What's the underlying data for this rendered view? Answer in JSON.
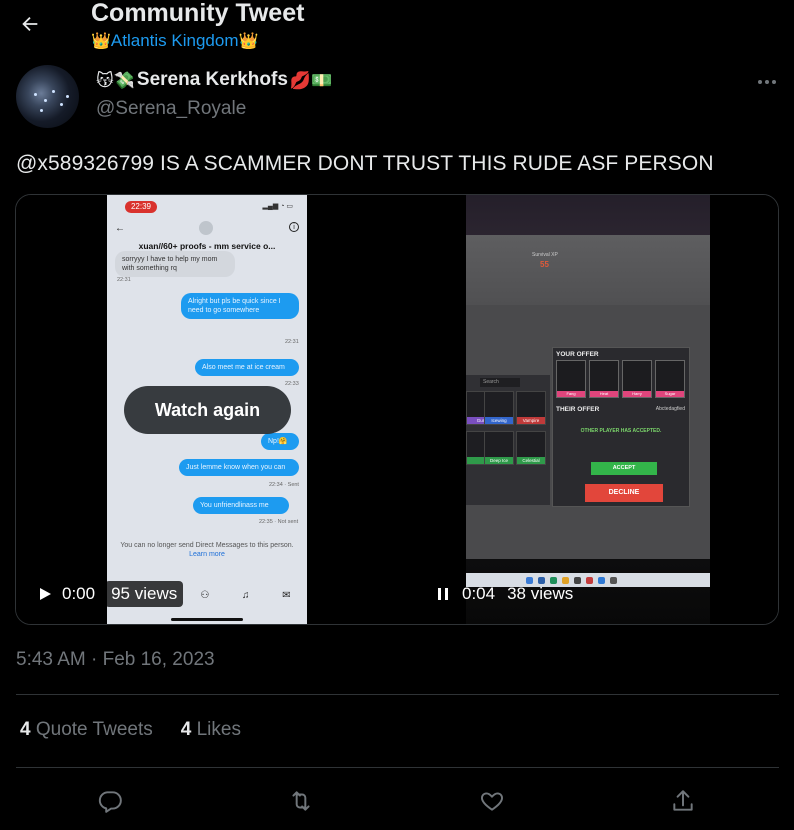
{
  "header": {
    "title": "Community Tweet",
    "community": "Atlantis Kingdom",
    "community_emoji": "👑"
  },
  "author": {
    "name": "Serena Kerkhofs",
    "name_emoji_prefix": "😽💸",
    "name_emoji_suffix": "💋💵",
    "handle": "@Serena_Royale"
  },
  "tweet": {
    "text": "@x589326799 IS A SCAMMER DONT TRUST THIS RUDE ASF PERSON",
    "timestamp": "5:43 AM · Feb 16, 2023"
  },
  "media": {
    "video1": {
      "overlay_label": "Watch again",
      "time": "0:00",
      "views": "95 views",
      "screenshot": {
        "status_time": "22:39",
        "title": "xuan//60+ proofs - mm service o...",
        "msg_in_1": "sorryyy I have to help my mom with something rq",
        "msg_in_1_time": "22:31",
        "msg_out_1": "Alright but pls be quick since I need to go somewhere",
        "msg_out_1_time": "22:31",
        "msg_out_2": "Also meet me at ice cream",
        "msg_out_2_time": "22:33",
        "msg_out_3": "Np!🤗",
        "msg_out_4": "Just lemme know when you can",
        "msg_out_4_time": "22:34 · Sent",
        "msg_out_5": "You unfriendlinass me",
        "msg_out_5_time": "22:35 · Not sent",
        "notice_1": "You can no longer send Direct Messages to this person.",
        "notice_link": "Learn more"
      }
    },
    "video2": {
      "time": "0:04",
      "views": "38 views",
      "game": {
        "survival_label": "Survival XP",
        "survival_value": "55",
        "search_placeholder": "Search",
        "your_offer": "YOUR OFFER",
        "their_offer": "THEIR OFFER",
        "their_user": "Abctedagfied",
        "slot_tags": [
          "Fang",
          "Heat",
          "Harry",
          "Sugar"
        ],
        "inv_tags": [
          "Gun",
          "Icewing",
          "Vampire",
          "",
          "Deep Ice",
          "Celestial"
        ],
        "other_accepted": "OTHER PLAYER HAS ACCEPTED.",
        "accept": "ACCEPT",
        "decline": "DECLINE"
      }
    }
  },
  "stats": {
    "quote_count": "4",
    "quote_label": "Quote Tweets",
    "likes_count": "4",
    "likes_label": "Likes"
  },
  "actions": [
    "reply-icon",
    "retweet-icon",
    "like-icon",
    "share-icon"
  ]
}
